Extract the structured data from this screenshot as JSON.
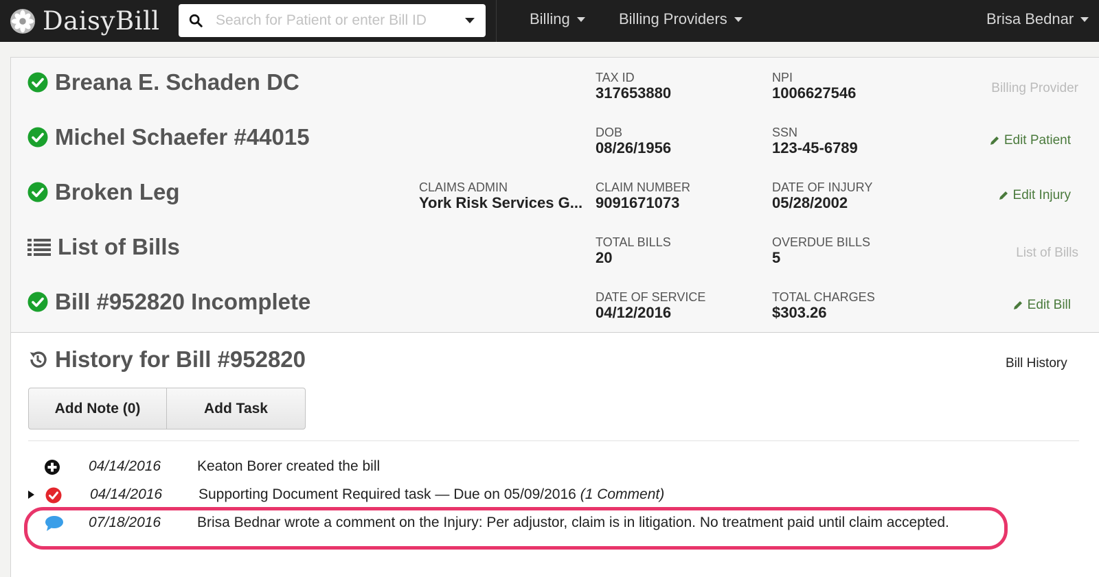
{
  "brand": {
    "name": "DaisyBill",
    "logo_icon": "daisy-logo-icon"
  },
  "search": {
    "placeholder": "Search for Patient or enter Bill ID",
    "value": ""
  },
  "nav": {
    "items": [
      {
        "label": "Billing"
      },
      {
        "label": "Billing Providers"
      }
    ],
    "user": "Brisa Bednar"
  },
  "colors": {
    "accent_green": "#1aa12d",
    "link_green": "#4a7a3c",
    "highlight": "#e8356a",
    "navbar": "#1f1f1f"
  },
  "rows": {
    "provider": {
      "title": "Breana E. Schaden DC",
      "status_icon": "check-circle-icon",
      "f1_label": "TAX ID",
      "f1_value": "317653880",
      "f2_label": "NPI",
      "f2_value": "1006627546",
      "action": "Billing Provider"
    },
    "patient": {
      "title": "Michel Schaefer #44015",
      "status_icon": "check-circle-icon",
      "f1_label": "DOB",
      "f1_value": "08/26/1956",
      "f2_label": "SSN",
      "f2_value": "123-45-6789",
      "action": "Edit Patient"
    },
    "injury": {
      "title": "Broken Leg",
      "status_icon": "check-circle-icon",
      "f0_label": "CLAIMS ADMIN",
      "f0_value": "York Risk Services G...",
      "f1_label": "CLAIM NUMBER",
      "f1_value": "9091671073",
      "f2_label": "DATE OF INJURY",
      "f2_value": "05/28/2002",
      "action": "Edit Injury"
    },
    "bills": {
      "title": "List of Bills",
      "status_icon": "list-icon",
      "f1_label": "TOTAL BILLS",
      "f1_value": "20",
      "f2_label": "OVERDUE BILLS",
      "f2_value": "5",
      "action": "List of Bills"
    },
    "bill": {
      "title": "Bill #952820 Incomplete",
      "status_icon": "check-circle-icon",
      "f1_label": "DATE OF SERVICE",
      "f1_value": "04/12/2016",
      "f2_label": "TOTAL CHARGES",
      "f2_value": "$303.26",
      "action": "Edit Bill"
    }
  },
  "history": {
    "title": "History for Bill #952820",
    "section_label": "Bill History",
    "buttons": {
      "add_note": "Add Note (0)",
      "add_task": "Add Task"
    },
    "items": [
      {
        "icon": "plus-circle-icon",
        "date": "04/14/2016",
        "text": "Keaton Borer created the bill"
      },
      {
        "icon": "red-check-circle-icon",
        "date": "04/14/2016",
        "text": "Supporting Document Required task — Due on 05/09/2016",
        "comment_count": "(1 Comment)"
      },
      {
        "icon": "speech-bubble-icon",
        "date": "07/18/2016",
        "text": "Brisa Bednar wrote a comment on the Injury: Per adjustor, claim is in litigation. No treatment paid until claim accepted."
      }
    ]
  }
}
